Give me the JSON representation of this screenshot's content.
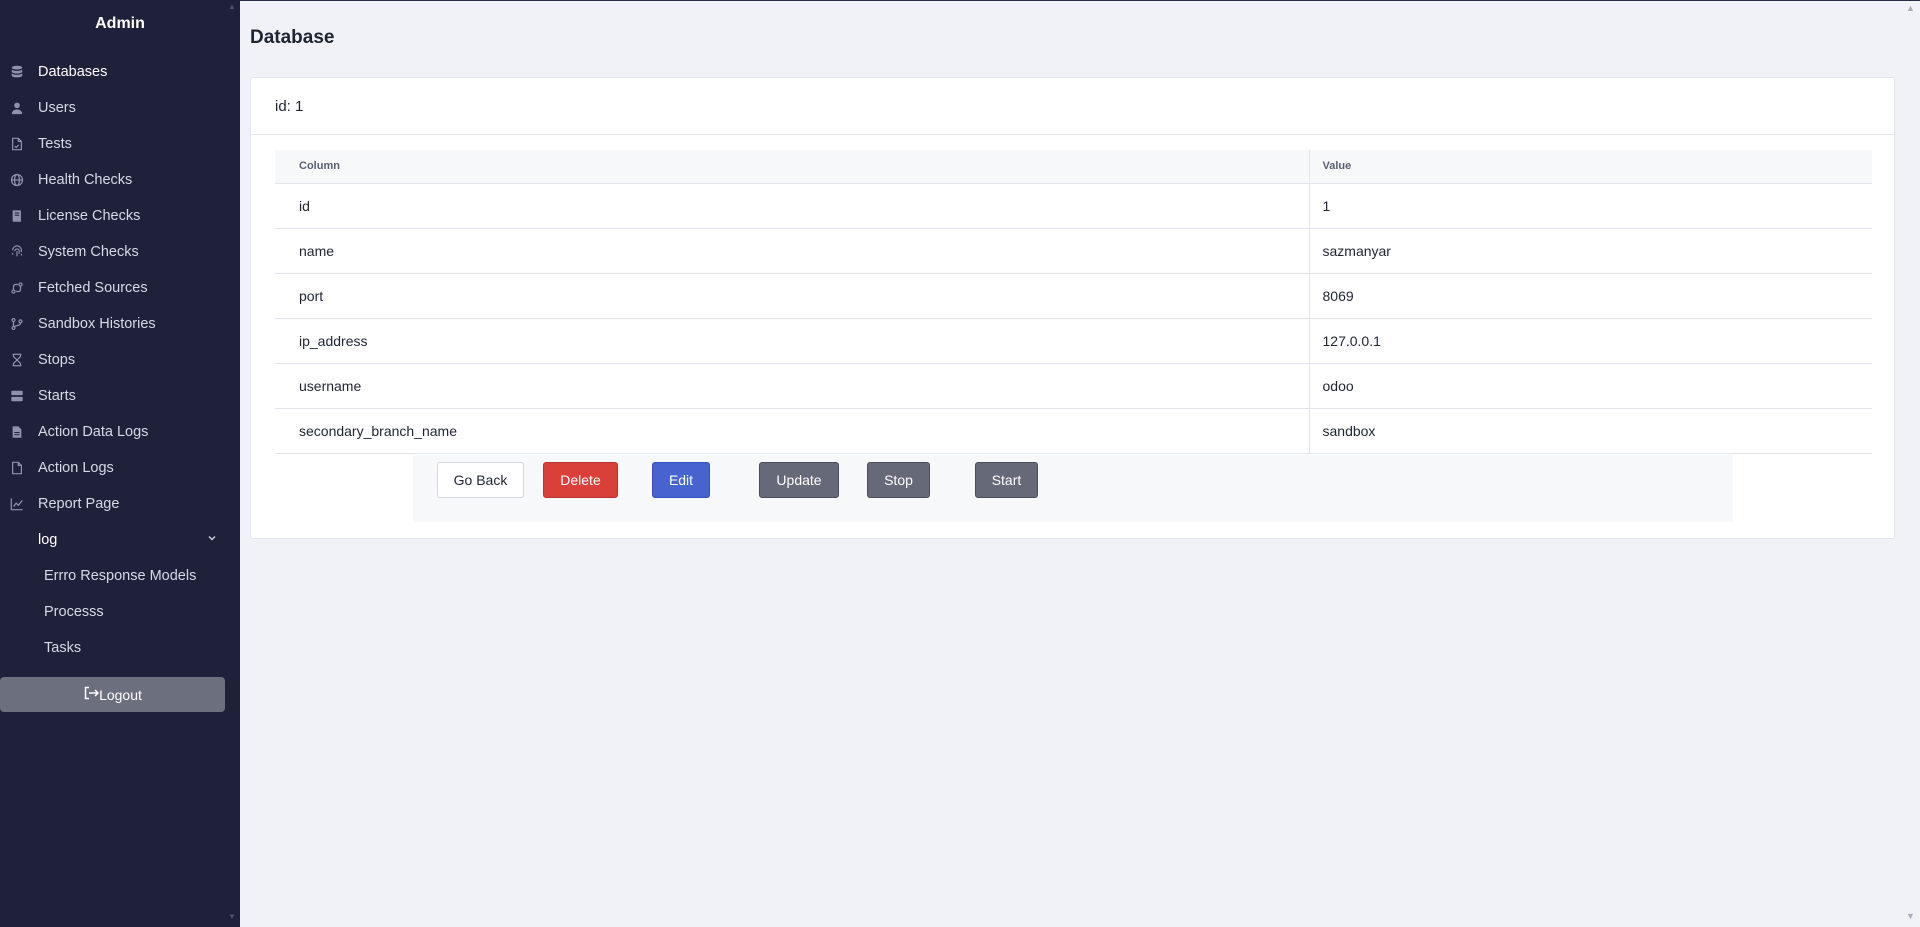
{
  "sidebar": {
    "brand": "Admin",
    "items": [
      {
        "label": "Databases",
        "icon": "database-icon"
      },
      {
        "label": "Users",
        "icon": "user-icon"
      },
      {
        "label": "Tests",
        "icon": "file-icon"
      },
      {
        "label": "Health Checks",
        "icon": "globe-icon"
      },
      {
        "label": "License Checks",
        "icon": "book-icon"
      },
      {
        "label": "System Checks",
        "icon": "fingerprint-icon"
      },
      {
        "label": "Fetched Sources",
        "icon": "git-compare-icon"
      },
      {
        "label": "Sandbox Histories",
        "icon": "git-branch-icon"
      },
      {
        "label": "Stops",
        "icon": "hourglass-icon"
      },
      {
        "label": "Starts",
        "icon": "server-icon"
      },
      {
        "label": "Action Data Logs",
        "icon": "file-text-icon"
      },
      {
        "label": "Action Logs",
        "icon": "file-icon"
      },
      {
        "label": "Report Page",
        "icon": "chart-line-icon"
      }
    ],
    "group": {
      "label": "log",
      "items": [
        {
          "label": "Errro Response Models"
        },
        {
          "label": "Processs"
        },
        {
          "label": "Tasks"
        }
      ]
    },
    "logout_label": "Logout"
  },
  "main": {
    "title": "Database",
    "card_header": "id: 1",
    "table": {
      "headers": [
        "Column",
        "Value"
      ],
      "rows": [
        {
          "key": "id",
          "value": "1"
        },
        {
          "key": "name",
          "value": "sazmanyar"
        },
        {
          "key": "port",
          "value": "8069"
        },
        {
          "key": "ip_address",
          "value": "127.0.0.1"
        },
        {
          "key": "username",
          "value": "odoo"
        },
        {
          "key": "secondary_branch_name",
          "value": "sandbox"
        }
      ]
    },
    "buttons": {
      "go_back": "Go Back",
      "delete": "Delete",
      "edit": "Edit",
      "update": "Update",
      "stop": "Stop",
      "start": "Start"
    }
  },
  "colors": {
    "sidebar_bg": "#1e2139",
    "page_bg": "#f1f2f7",
    "danger": "#d9403a",
    "primary": "#4663d0",
    "secondary": "#666a78"
  }
}
